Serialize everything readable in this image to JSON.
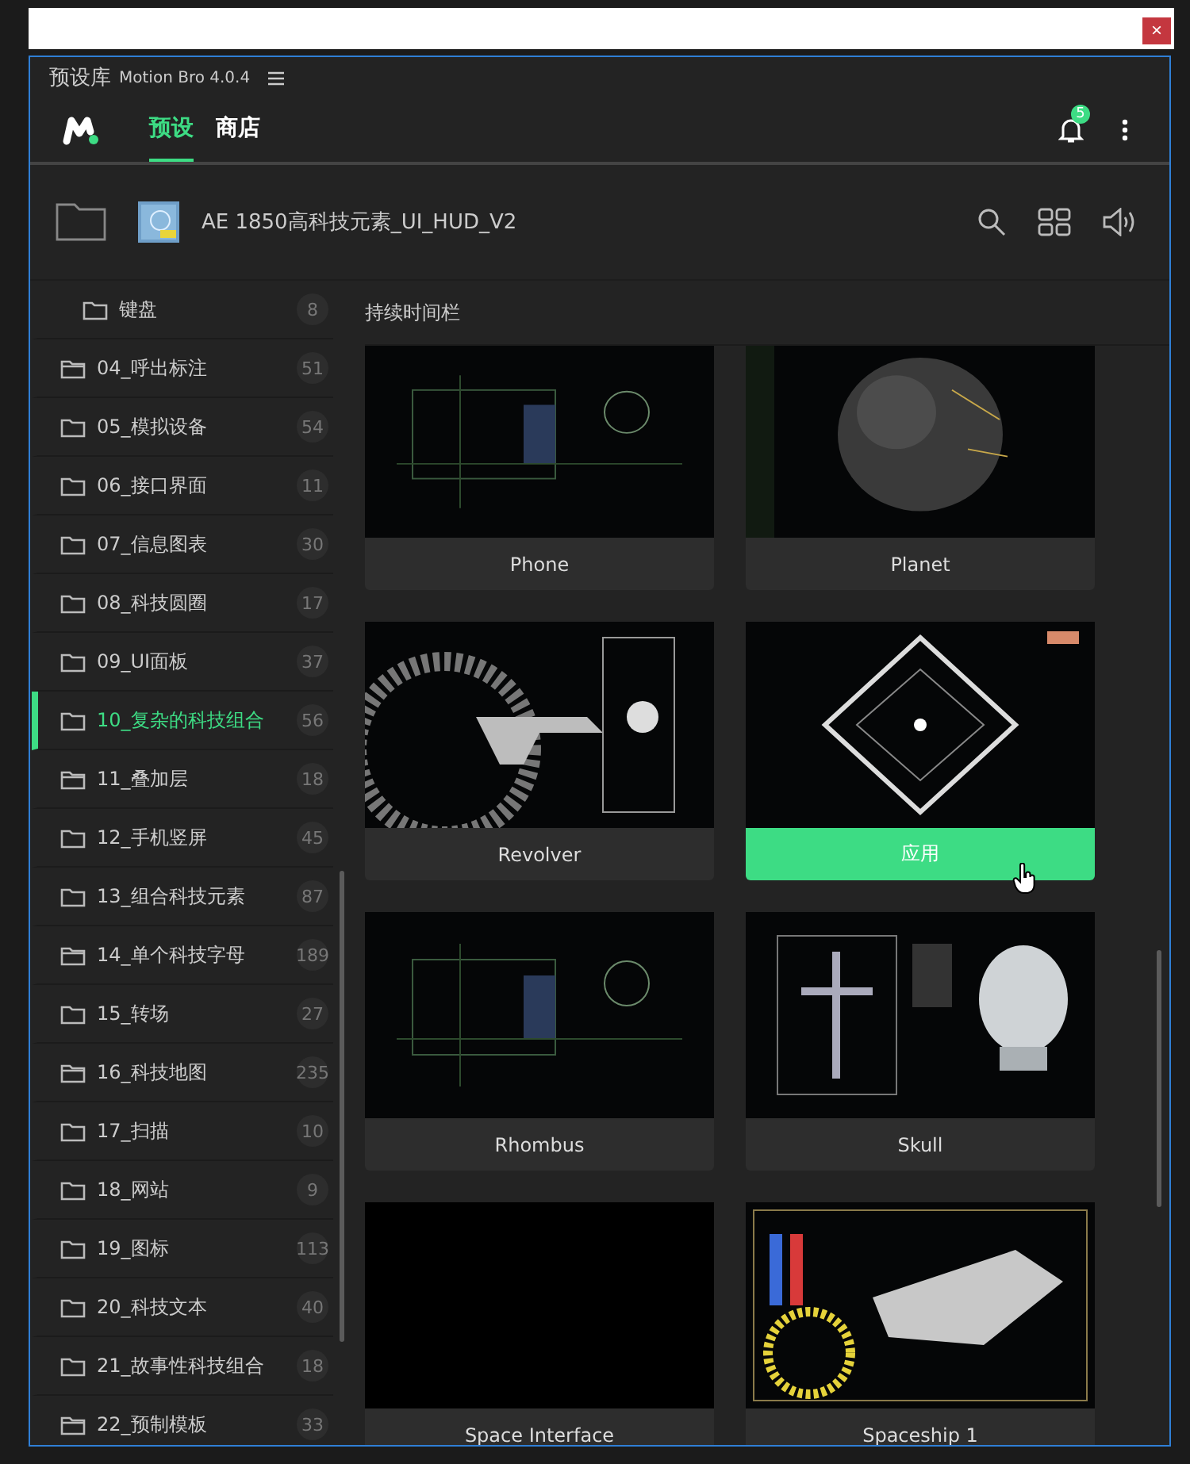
{
  "window": {
    "title": "预设库",
    "version": "Motion Bro 4.0.4",
    "close": "×"
  },
  "tabs": [
    {
      "label": "预设",
      "selected": true
    },
    {
      "label": "商店",
      "selected": false
    }
  ],
  "notifications": {
    "count": "5"
  },
  "toolbar": {
    "project": "AE 1850高科技元素_UI_HUD_V2"
  },
  "sidebar": {
    "items": [
      {
        "label": "键盘",
        "count": "8",
        "kind": "child",
        "selected": false
      },
      {
        "label": "04_呼出标注",
        "count": "51",
        "kind": "stacked",
        "selected": false
      },
      {
        "label": "05_模拟设备",
        "count": "54",
        "kind": "plain",
        "selected": false
      },
      {
        "label": "06_接口界面",
        "count": "11",
        "kind": "plain",
        "selected": false
      },
      {
        "label": "07_信息图表",
        "count": "30",
        "kind": "plain",
        "selected": false
      },
      {
        "label": "08_科技圆圈",
        "count": "17",
        "kind": "plain",
        "selected": false
      },
      {
        "label": "09_UI面板",
        "count": "37",
        "kind": "plain",
        "selected": false
      },
      {
        "label": "10_复杂的科技组合",
        "count": "56",
        "kind": "plain",
        "selected": true
      },
      {
        "label": "11_叠加层",
        "count": "18",
        "kind": "stacked",
        "selected": false
      },
      {
        "label": "12_手机竖屏",
        "count": "45",
        "kind": "plain",
        "selected": false
      },
      {
        "label": "13_组合科技元素",
        "count": "87",
        "kind": "plain",
        "selected": false
      },
      {
        "label": "14_单个科技字母",
        "count": "189",
        "kind": "stacked",
        "selected": false
      },
      {
        "label": "15_转场",
        "count": "27",
        "kind": "plain",
        "selected": false
      },
      {
        "label": "16_科技地图",
        "count": "235",
        "kind": "stacked",
        "selected": false
      },
      {
        "label": "17_扫描",
        "count": "10",
        "kind": "plain",
        "selected": false
      },
      {
        "label": "18_网站",
        "count": "9",
        "kind": "plain",
        "selected": false
      },
      {
        "label": "19_图标",
        "count": "113",
        "kind": "plain",
        "selected": false
      },
      {
        "label": "20_科技文本",
        "count": "40",
        "kind": "plain",
        "selected": false
      },
      {
        "label": "21_故事性科技组合",
        "count": "18",
        "kind": "plain",
        "selected": false
      },
      {
        "label": "22_预制模板",
        "count": "33",
        "kind": "stacked",
        "selected": false
      }
    ]
  },
  "content": {
    "heading": "持续时间栏",
    "cards": [
      {
        "label": "Phone",
        "kind": "picture",
        "hovered": false
      },
      {
        "label": "Planet",
        "kind": "picture",
        "hovered": false
      },
      {
        "label": "Revolver",
        "kind": "picture",
        "hovered": false
      },
      {
        "label": "应用",
        "kind": "picture",
        "hovered": true
      },
      {
        "label": "Rhombus",
        "kind": "picture",
        "hovered": false
      },
      {
        "label": "Skull",
        "kind": "picture",
        "hovered": false
      },
      {
        "label": "Space Interface",
        "kind": "empty",
        "hovered": false
      },
      {
        "label": "Spaceship 1",
        "kind": "picture",
        "hovered": false
      }
    ]
  }
}
